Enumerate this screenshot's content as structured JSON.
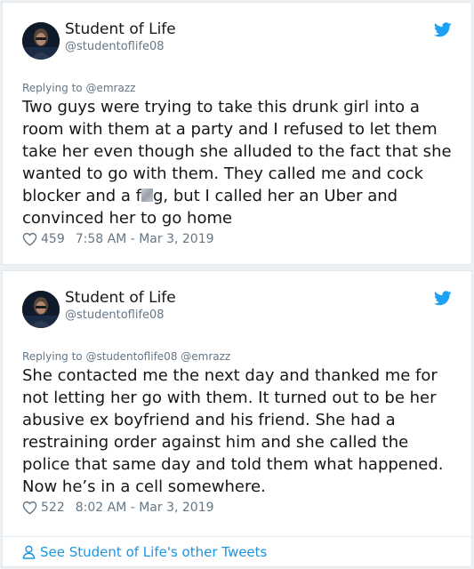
{
  "colors": {
    "accent": "#1da1f2",
    "link": "#1b95e0",
    "muted": "#657786",
    "text": "#14171a"
  },
  "tweets": [
    {
      "user": {
        "name": "Student of Life",
        "handle": "@studentoflife08"
      },
      "replying_to": "Replying to @emrazz",
      "text_before": "Two guys were trying to take this drunk girl into a room with them at a party and I refused to let them take her even though she alluded to the fact that she wanted to go with them. They called me and cock blocker and a f",
      "text_after": "g, but I called her an Uber and convinced her to go home",
      "likes": "459",
      "timestamp": "7:58 AM - Mar 3, 2019"
    },
    {
      "user": {
        "name": "Student of Life",
        "handle": "@studentoflife08"
      },
      "replying_to": "Replying to @studentoflife08 @emrazz",
      "text": "She contacted me the next day and thanked me for not letting her go with them. It turned out to be her abusive ex boyfriend and his friend. She had a restraining order against him and she called the police that same day and told them what happened. Now he’s in a cell somewhere.",
      "likes": "522",
      "timestamp": "8:02 AM - Mar 3, 2019"
    }
  ],
  "footer": {
    "link_text": "See Student of Life's other Tweets"
  },
  "icons": [
    "avatar-photo",
    "twitter-bird-icon",
    "heart-icon",
    "person-icon"
  ]
}
